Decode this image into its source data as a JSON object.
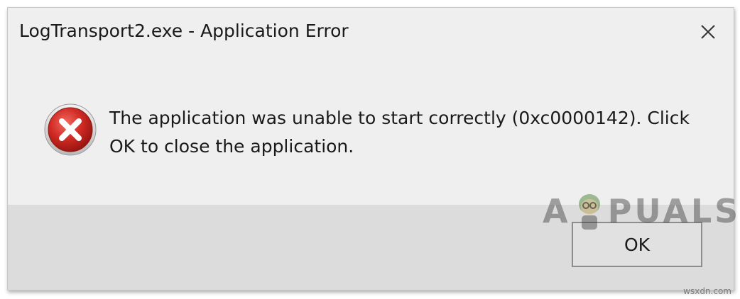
{
  "dialog": {
    "title": "LogTransport2.exe - Application Error",
    "close_icon": "close-icon",
    "error_icon": "error-x-icon",
    "message": "The application was unable to start correctly (0xc0000142). Click OK to close the application.",
    "ok_label": "OK"
  },
  "watermark": {
    "logo_text_left": "A",
    "logo_text_right": "PUALS",
    "site": "wsxdn.com"
  },
  "colors": {
    "dialog_bg": "#efefef",
    "footer_bg": "#dcdcdc",
    "error_red": "#c62828"
  }
}
